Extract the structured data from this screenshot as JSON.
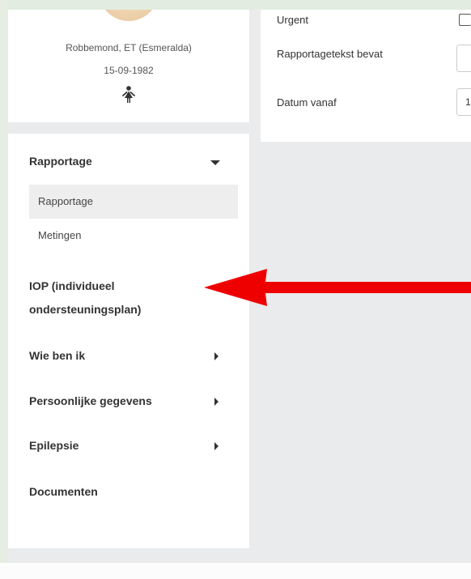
{
  "patient": {
    "name": "Robbemond, ET  (Esmeralda)",
    "dob": "15-09-1982",
    "gender_icon": "female-person-icon"
  },
  "filters": {
    "urgent_label": "Urgent",
    "text_contains_label": "Rapportagetekst bevat",
    "text_contains_value": "",
    "date_from_label": "Datum vanaf",
    "date_from_value": "1"
  },
  "nav": {
    "rapportage": {
      "label": "Rapportage",
      "icon": "caret-down-icon",
      "items": [
        {
          "label": "Rapportage",
          "active": true
        },
        {
          "label": "Metingen",
          "active": false
        }
      ]
    },
    "iop": {
      "label_line1": "IOP (individueel",
      "label_line2": "ondersteuningsplan)"
    },
    "wie_ben_ik": {
      "label": "Wie ben ik",
      "icon": "caret-right-icon"
    },
    "persoonlijke_gegevens": {
      "label": "Persoonlijke gegevens",
      "icon": "caret-right-icon"
    },
    "epilepsie": {
      "label": "Epilepsie",
      "icon": "caret-right-icon"
    },
    "documenten": {
      "label": "Documenten"
    }
  },
  "annotation": {
    "arrow_color": "#ee0000",
    "icon": "red-arrow-left-icon"
  },
  "colors": {
    "background": "#eaebec",
    "panel": "#ffffff",
    "active_item": "#eeeeee",
    "text": "#333333"
  }
}
